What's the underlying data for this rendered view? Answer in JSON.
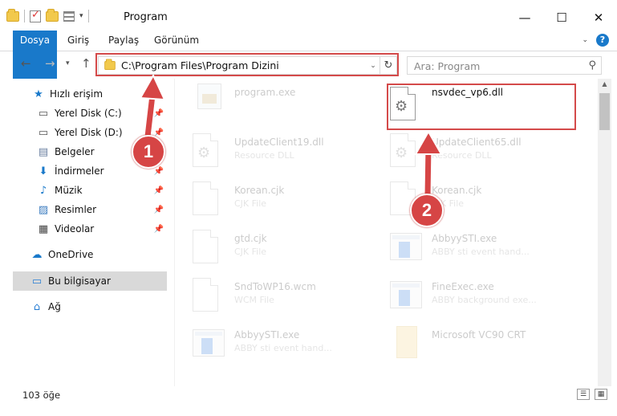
{
  "window": {
    "title": "Program",
    "min_label": "—",
    "max_label": "☐",
    "close_label": "✕"
  },
  "ribbon": {
    "tabs": [
      "Dosya",
      "Giriş",
      "Paylaş",
      "Görünüm"
    ],
    "help": "?"
  },
  "address": {
    "path": "C:\\Program Files\\Program Dizini",
    "search_placeholder": "Ara: Program"
  },
  "sidebar": {
    "items": [
      {
        "label": "Hızlı erişim",
        "icon": "star-icon",
        "pinned": false
      },
      {
        "label": "Yerel Disk (C:)",
        "icon": "drive-icon",
        "pinned": true
      },
      {
        "label": "Yerel Disk (D:)",
        "icon": "drive-icon",
        "pinned": true
      },
      {
        "label": "Belgeler",
        "icon": "documents-icon",
        "pinned": true
      },
      {
        "label": "İndirmeler",
        "icon": "download-icon",
        "pinned": true
      },
      {
        "label": "Müzik",
        "icon": "music-icon",
        "pinned": true
      },
      {
        "label": "Resimler",
        "icon": "pictures-icon",
        "pinned": true
      },
      {
        "label": "Videolar",
        "icon": "videos-icon",
        "pinned": true
      },
      {
        "label": "OneDrive",
        "icon": "cloud-icon",
        "pinned": false
      },
      {
        "label": "Bu bilgisayar",
        "icon": "computer-icon",
        "pinned": false,
        "selected": true
      },
      {
        "label": "Ağ",
        "icon": "network-icon",
        "pinned": false
      }
    ]
  },
  "files": [
    {
      "name": "program.exe",
      "type": "",
      "icon": "exe-icon",
      "faded": true
    },
    {
      "name": "nsvdec_vp6.dll",
      "type": "",
      "icon": "dll-gear-icon",
      "faded": false
    },
    {
      "name": "UpdateClient19.dll",
      "type": "Resource DLL",
      "icon": "dll-gear-icon",
      "faded": true
    },
    {
      "name": "UpdateClient65.dll",
      "type": "Resource DLL",
      "icon": "dll-gear-icon",
      "faded": true
    },
    {
      "name": "Korean.cjk",
      "type": "CJK File",
      "icon": "document-icon",
      "faded": true
    },
    {
      "name": "Korean.cjk",
      "type": "CJK File",
      "icon": "document-icon",
      "faded": true
    },
    {
      "name": "gtd.cjk",
      "type": "CJK File",
      "icon": "document-icon",
      "faded": true
    },
    {
      "name": "AbbyySTI.exe",
      "type": "ABBY sti event hand...",
      "icon": "app-icon",
      "faded": true
    },
    {
      "name": "SndToWP16.wcm",
      "type": "WCM File",
      "icon": "document-icon",
      "faded": true
    },
    {
      "name": "FineExec.exe",
      "type": "ABBY background exe...",
      "icon": "app-icon",
      "faded": true
    },
    {
      "name": "AbbyySTI.exe",
      "type": "ABBY sti event hand...",
      "icon": "app-icon",
      "faded": true
    },
    {
      "name": "Microsoft VC90 CRT",
      "type": "",
      "icon": "folder-icon",
      "faded": true
    }
  ],
  "status": {
    "count": "103 öğe"
  },
  "annotations": {
    "step1": "1",
    "step2": "2",
    "color": "#d64545"
  }
}
